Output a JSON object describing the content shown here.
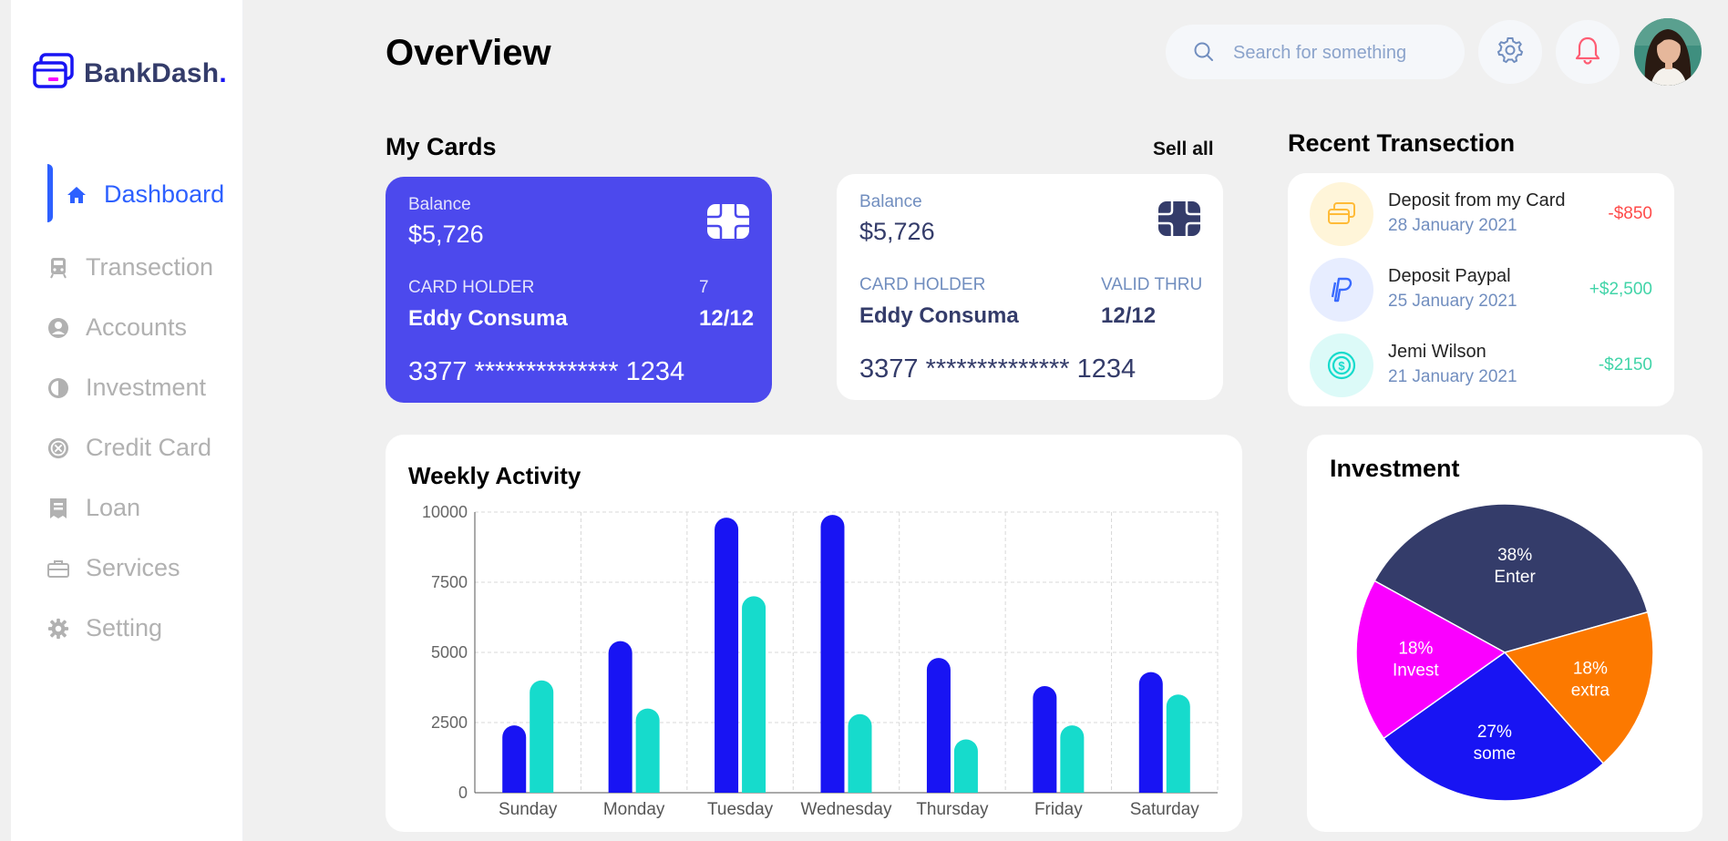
{
  "brand": {
    "name": "BankDash",
    "dot": "."
  },
  "sidebar": {
    "items": [
      {
        "label": "Dashboard",
        "icon": "home-icon",
        "active": true
      },
      {
        "label": "Transection",
        "icon": "transfer-icon"
      },
      {
        "label": "Accounts",
        "icon": "user-icon"
      },
      {
        "label": "Investment",
        "icon": "investment-icon"
      },
      {
        "label": "Credit Card",
        "icon": "credit-card-icon"
      },
      {
        "label": "Loan",
        "icon": "loan-icon"
      },
      {
        "label": "Services",
        "icon": "briefcase-icon"
      },
      {
        "label": "Setting",
        "icon": "gear-icon"
      }
    ]
  },
  "header": {
    "title": "OverView",
    "search_placeholder": "Search for something"
  },
  "my_cards": {
    "title": "My Cards",
    "see_all": "Sell all",
    "cards": [
      {
        "balance_label": "Balance",
        "balance": "$5,726",
        "holder_label": "CARD HOLDER",
        "holder": "Eddy Consuma",
        "valid_label": "7",
        "valid": "12/12",
        "number": "3377 ************** 1234",
        "theme": "#4c49ed"
      },
      {
        "balance_label": "Balance",
        "balance": "$5,726",
        "holder_label": "CARD HOLDER",
        "holder": "Eddy Consuma",
        "valid_label": "VALID THRU",
        "valid": "12/12",
        "number": "3377 ************** 1234",
        "theme": "#ffffff"
      }
    ]
  },
  "recent": {
    "title": "Recent Transection",
    "items": [
      {
        "title": "Deposit from my Card",
        "date": "28 January 2021",
        "amount": "-$850",
        "icon": "card-icon",
        "amount_color": "#ff4b4a"
      },
      {
        "title": "Deposit Paypal",
        "date": "25 January 2021",
        "amount": "+$2,500",
        "icon": "paypal-icon",
        "amount_color": "#41d4a8"
      },
      {
        "title": "Jemi Wilson",
        "date": "21 January 2021",
        "amount": "-$2150",
        "icon": "dollar-coin-icon",
        "amount_color": "#41d4a8"
      }
    ]
  },
  "weekly": {
    "title": "Weekly Activity"
  },
  "investment": {
    "title": "Investment"
  },
  "chart_data": [
    {
      "type": "bar",
      "title": "Weekly Activity",
      "categories": [
        "Sunday",
        "Monday",
        "Tuesday",
        "Wednesday",
        "Thursday",
        "Friday",
        "Saturday"
      ],
      "series": [
        {
          "values": [
            2400,
            5400,
            9800,
            9900,
            4800,
            3800,
            4300
          ],
          "color": "#1814f3"
        },
        {
          "values": [
            4000,
            3000,
            7000,
            2800,
            1900,
            2400,
            3500
          ],
          "color": "#16dbcc"
        }
      ],
      "ylim": [
        0,
        10000
      ],
      "yticks": [
        "0",
        "2500",
        "5000",
        "7500",
        "10000"
      ],
      "grid": true
    },
    {
      "type": "pie",
      "title": "Investment",
      "slices": [
        {
          "label": "Enter",
          "pct_label": "38%",
          "value": 38,
          "color": "#343c6a"
        },
        {
          "label": "extra",
          "pct_label": "18%",
          "value": 18,
          "color": "#fc7900"
        },
        {
          "label": "some",
          "pct_label": "27%",
          "value": 27,
          "color": "#1814f3"
        },
        {
          "label": "Invest",
          "pct_label": "18%",
          "value": 18,
          "color": "#fa00ff"
        }
      ]
    }
  ]
}
